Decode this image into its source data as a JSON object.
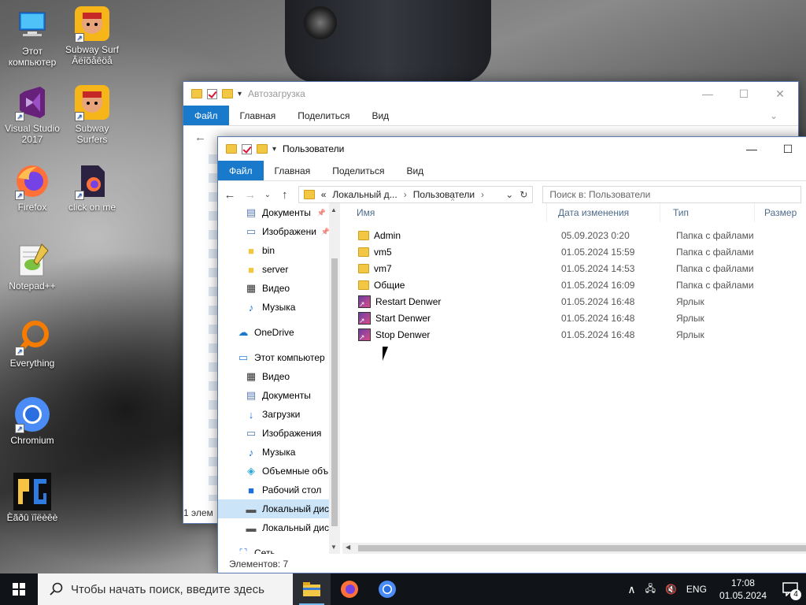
{
  "desktop": {
    "icons": [
      {
        "label": "Этот компьютер",
        "icon": "computer-icon"
      },
      {
        "label": "Subway Surf Âëîõåêöå",
        "icon": "subway-surfers-icon"
      },
      {
        "label": "Visual Studio 2017",
        "icon": "visual-studio-icon"
      },
      {
        "label": "Subway Surfers",
        "icon": "subway-surfers-icon"
      },
      {
        "label": "Firefox",
        "icon": "firefox-icon"
      },
      {
        "label": "click on me",
        "icon": "firefox-file-icon"
      },
      {
        "label": "Notepad++",
        "icon": "notepadpp-icon"
      },
      {
        "label": "Everything",
        "icon": "everything-icon"
      },
      {
        "label": "Chromium",
        "icon": "chromium-icon"
      },
      {
        "label": "Èãðû ïîëèêè",
        "icon": "game-icon"
      }
    ]
  },
  "back_window": {
    "title": "Автозагрузка",
    "tabs": [
      "Файл",
      "Главная",
      "Поделиться",
      "Вид"
    ],
    "status": "1 элем"
  },
  "front_window": {
    "title": "Пользователи",
    "tabs": [
      "Файл",
      "Главная",
      "Поделиться",
      "Вид"
    ],
    "address": {
      "prefix": "«",
      "parts": [
        "Локальный д...",
        "Пользователи"
      ]
    },
    "search_placeholder": "Поиск в: Пользователи",
    "sidebar": [
      {
        "label": "Документы",
        "icon": "documents-icon",
        "pinned": true
      },
      {
        "label": "Изображени",
        "icon": "pictures-icon",
        "pinned": true
      },
      {
        "label": "bin",
        "icon": "folder-icon"
      },
      {
        "label": "server",
        "icon": "folder-icon"
      },
      {
        "label": "Видео",
        "icon": "video-icon"
      },
      {
        "label": "Музыка",
        "icon": "music-icon"
      },
      {
        "label": "OneDrive",
        "icon": "onedrive-icon",
        "level": 0
      },
      {
        "label": "Этот компьютер",
        "icon": "computer-icon",
        "level": 0
      },
      {
        "label": "Видео",
        "icon": "video-icon"
      },
      {
        "label": "Документы",
        "icon": "documents-icon"
      },
      {
        "label": "Загрузки",
        "icon": "downloads-icon"
      },
      {
        "label": "Изображения",
        "icon": "pictures-icon"
      },
      {
        "label": "Музыка",
        "icon": "music-icon"
      },
      {
        "label": "Объемные объ",
        "icon": "3d-objects-icon"
      },
      {
        "label": "Рабочий стол",
        "icon": "desktop-icon"
      },
      {
        "label": "Локальный дис",
        "icon": "drive-icon",
        "selected": true
      },
      {
        "label": "Локальный дис",
        "icon": "drive-icon"
      },
      {
        "label": "Сеть",
        "icon": "network-icon",
        "level": 0
      }
    ],
    "columns": [
      "Имя",
      "Дата изменения",
      "Тип",
      "Размер"
    ],
    "files": [
      {
        "name": "Admin",
        "date": "05.09.2023 0:20",
        "type": "Папка с файлами",
        "icon": "folder-icon"
      },
      {
        "name": "vm5",
        "date": "01.05.2024 15:59",
        "type": "Папка с файлами",
        "icon": "folder-icon"
      },
      {
        "name": "vm7",
        "date": "01.05.2024 14:53",
        "type": "Папка с файлами",
        "icon": "folder-icon"
      },
      {
        "name": "Общие",
        "date": "01.05.2024 16:09",
        "type": "Папка с файлами",
        "icon": "folder-icon"
      },
      {
        "name": "Restart Denwer",
        "date": "01.05.2024 16:48",
        "type": "Ярлык",
        "icon": "shortcut-icon"
      },
      {
        "name": "Start Denwer",
        "date": "01.05.2024 16:48",
        "type": "Ярлык",
        "icon": "shortcut-icon"
      },
      {
        "name": "Stop Denwer",
        "date": "01.05.2024 16:48",
        "type": "Ярлык",
        "icon": "shortcut-icon"
      }
    ],
    "status": "Элементов: 7"
  },
  "taskbar": {
    "search_placeholder": "Чтобы начать поиск, введите здесь",
    "lang": "ENG",
    "time": "17:08",
    "date": "01.05.2024",
    "notifications": "4"
  },
  "colors": {
    "accent": "#1979ca",
    "selection": "#cce4f7",
    "folder": "#f2c744",
    "taskbar": "#101317"
  }
}
